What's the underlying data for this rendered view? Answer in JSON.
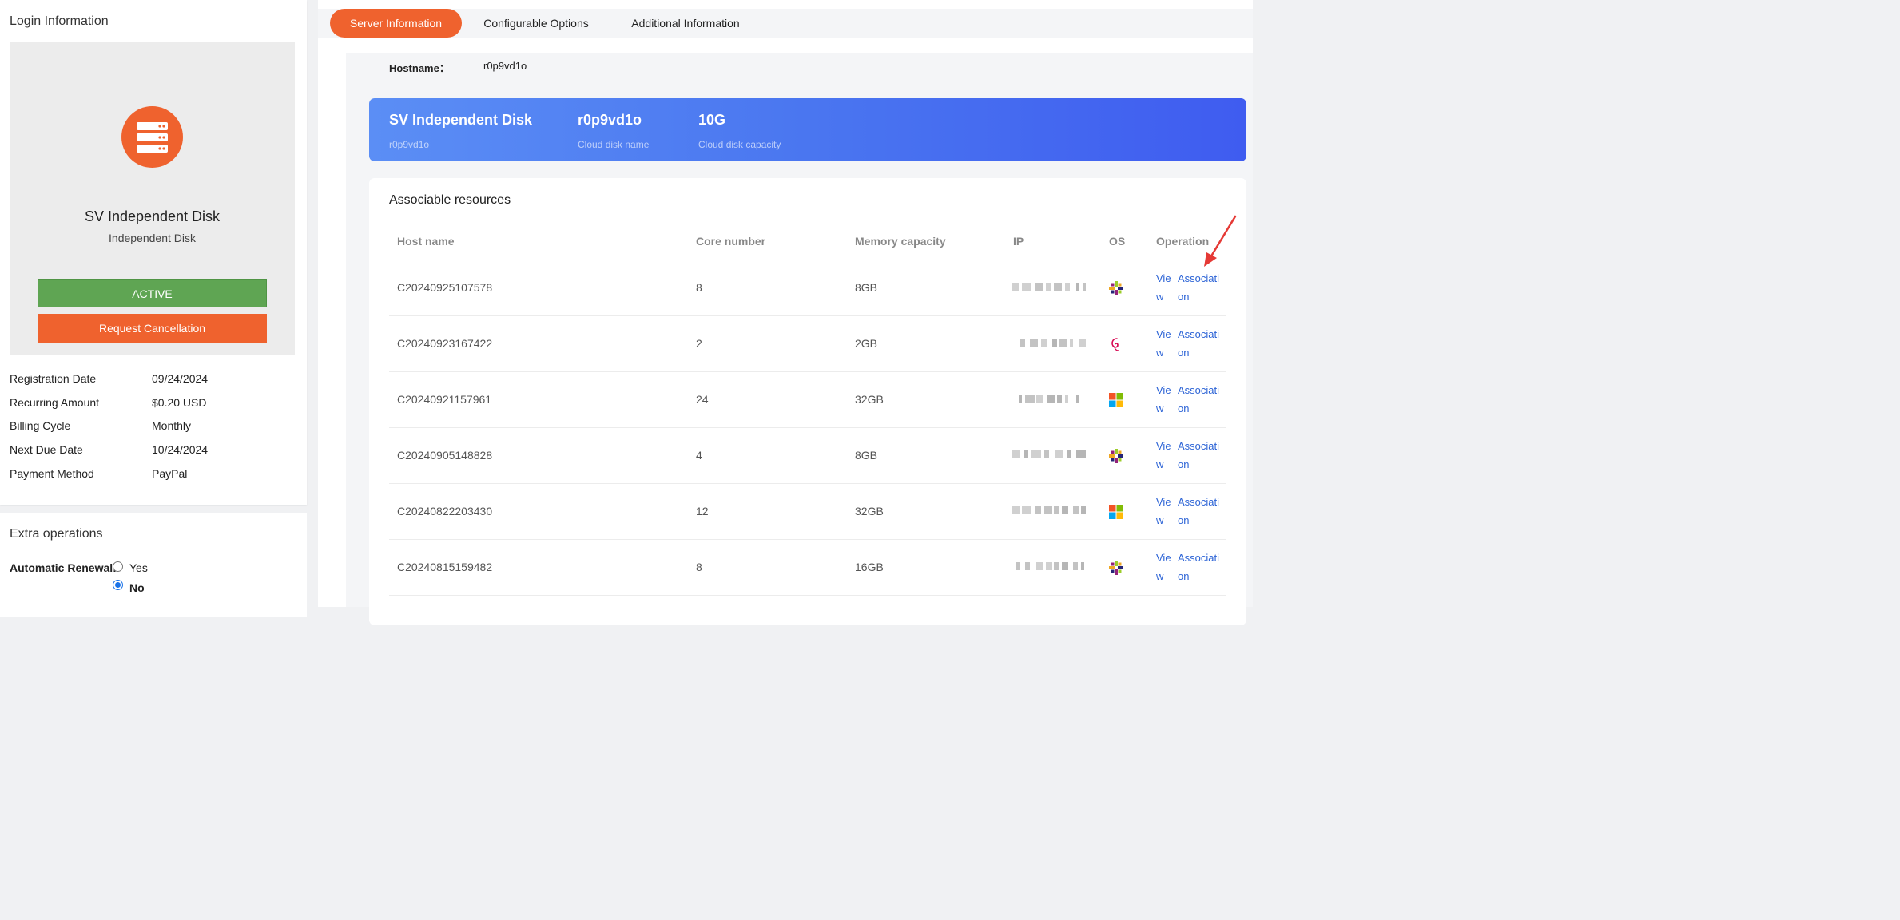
{
  "login": {
    "title": "Login Information",
    "product_name": "SV Independent Disk",
    "product_type": "Independent Disk",
    "status": "ACTIVE",
    "cancel_label": "Request Cancellation",
    "status_color": "#5fa553",
    "accent_color": "#ef622e",
    "details": [
      {
        "label": "Registration Date",
        "value": "09/24/2024"
      },
      {
        "label": "Recurring Amount",
        "value": "$0.20 USD"
      },
      {
        "label": "Billing Cycle",
        "value": "Monthly"
      },
      {
        "label": "Next Due Date",
        "value": "10/24/2024"
      },
      {
        "label": "Payment Method",
        "value": "PayPal"
      }
    ]
  },
  "extra": {
    "title": "Extra operations",
    "renew_label": "Automatic Renewal:",
    "options": [
      {
        "label": "Yes",
        "checked": false
      },
      {
        "label": "No",
        "checked": true
      }
    ]
  },
  "tabs": [
    {
      "label": "Server Information",
      "active": true
    },
    {
      "label": "Configurable Options",
      "active": false
    },
    {
      "label": "Additional Information",
      "active": false
    }
  ],
  "server": {
    "hostname_label": "Hostname：",
    "hostname_value": "r0p9vd1o",
    "banner": {
      "product": "SV Independent Disk",
      "product_sub": "r0p9vd1o",
      "disk_name": "r0p9vd1o",
      "disk_name_label": "Cloud disk name",
      "capacity": "10G",
      "capacity_label": "Cloud disk capacity"
    }
  },
  "resources": {
    "title": "Associable resources",
    "columns": [
      "Host name",
      "Core number",
      "Memory capacity",
      "IP",
      "OS",
      "Operation"
    ],
    "rows": [
      {
        "host": "C20240925107578",
        "cores": "8",
        "memory": "8GB",
        "os": "centos-icon",
        "view": "Vie",
        "view2": "w",
        "assoc": "Associati",
        "assoc2": "on"
      },
      {
        "host": "C20240923167422",
        "cores": "2",
        "memory": "2GB",
        "os": "debian-icon",
        "view": "Vie",
        "view2": "w",
        "assoc": "Associati",
        "assoc2": "on"
      },
      {
        "host": "C20240921157961",
        "cores": "24",
        "memory": "32GB",
        "os": "windows-icon",
        "view": "Vie",
        "view2": "w",
        "assoc": "Associati",
        "assoc2": "on"
      },
      {
        "host": "C20240905148828",
        "cores": "4",
        "memory": "8GB",
        "os": "centos-icon",
        "view": "Vie",
        "view2": "w",
        "assoc": "Associati",
        "assoc2": "on"
      },
      {
        "host": "C20240822203430",
        "cores": "12",
        "memory": "32GB",
        "os": "windows-icon",
        "view": "Vie",
        "view2": "w",
        "assoc": "Associati",
        "assoc2": "on"
      },
      {
        "host": "C20240815159482",
        "cores": "8",
        "memory": "16GB",
        "os": "centos-icon",
        "view": "Vie",
        "view2": "w",
        "assoc": "Associati",
        "assoc2": "on"
      }
    ]
  }
}
